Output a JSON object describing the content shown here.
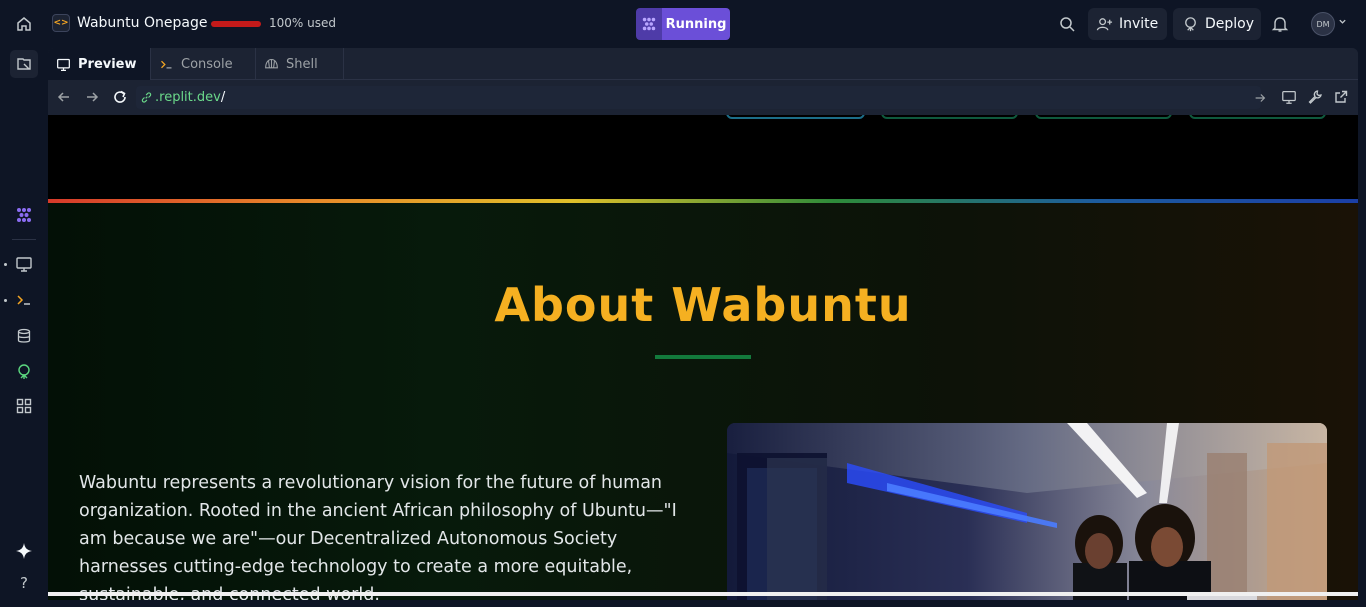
{
  "topbar": {
    "app_icon_glyph": "<>",
    "app_title": "Wabuntu Onepage",
    "usage_percent": 100,
    "usage_label": "100% used",
    "run_label": "Running",
    "invite_label": "Invite",
    "deploy_label": "Deploy",
    "avatar_initials": "DM"
  },
  "tabs": [
    {
      "label": "Preview",
      "icon": "monitor-icon",
      "active": true
    },
    {
      "label": "Console",
      "icon": "terminal-icon",
      "active": false
    },
    {
      "label": "Shell",
      "icon": "shell-icon",
      "active": false
    }
  ],
  "urlbar": {
    "host": ".replit.dev",
    "path": "/"
  },
  "rail": {
    "items": [
      "home-icon",
      "files-icon",
      "replit-agent-icon",
      "preview-icon",
      "console-icon",
      "database-icon",
      "deploy-icon",
      "apps-icon",
      "ai-icon",
      "help-icon"
    ],
    "help_glyph": "?"
  },
  "web": {
    "about_title": "About Wabuntu",
    "about_paragraph": "Wabuntu represents a revolutionary vision for the future of human organization. Rooted in the ancient African philosophy of Ubuntu—\"I am because we are\"—our Decentralized Autonomous Society harnesses cutting-edge technology to create a more equitable, sustainable, and connected world.",
    "image_subject": "two women working in a server room"
  },
  "colors": {
    "accent": "#6b4fd8",
    "title": "#f5b021",
    "url_host": "#6bd98a",
    "usage_bar": "#c41a1a"
  }
}
